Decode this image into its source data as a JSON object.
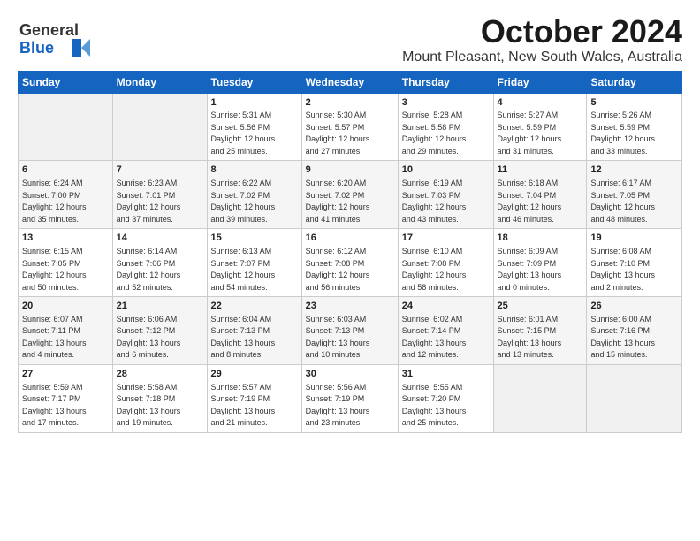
{
  "logo": {
    "line1": "General",
    "line2": "Blue"
  },
  "title": "October 2024",
  "subtitle": "Mount Pleasant, New South Wales, Australia",
  "days_of_week": [
    "Sunday",
    "Monday",
    "Tuesday",
    "Wednesday",
    "Thursday",
    "Friday",
    "Saturday"
  ],
  "weeks": [
    [
      {
        "day": "",
        "info": ""
      },
      {
        "day": "",
        "info": ""
      },
      {
        "day": "1",
        "info": "Sunrise: 5:31 AM\nSunset: 5:56 PM\nDaylight: 12 hours\nand 25 minutes."
      },
      {
        "day": "2",
        "info": "Sunrise: 5:30 AM\nSunset: 5:57 PM\nDaylight: 12 hours\nand 27 minutes."
      },
      {
        "day": "3",
        "info": "Sunrise: 5:28 AM\nSunset: 5:58 PM\nDaylight: 12 hours\nand 29 minutes."
      },
      {
        "day": "4",
        "info": "Sunrise: 5:27 AM\nSunset: 5:59 PM\nDaylight: 12 hours\nand 31 minutes."
      },
      {
        "day": "5",
        "info": "Sunrise: 5:26 AM\nSunset: 5:59 PM\nDaylight: 12 hours\nand 33 minutes."
      }
    ],
    [
      {
        "day": "6",
        "info": "Sunrise: 6:24 AM\nSunset: 7:00 PM\nDaylight: 12 hours\nand 35 minutes."
      },
      {
        "day": "7",
        "info": "Sunrise: 6:23 AM\nSunset: 7:01 PM\nDaylight: 12 hours\nand 37 minutes."
      },
      {
        "day": "8",
        "info": "Sunrise: 6:22 AM\nSunset: 7:02 PM\nDaylight: 12 hours\nand 39 minutes."
      },
      {
        "day": "9",
        "info": "Sunrise: 6:20 AM\nSunset: 7:02 PM\nDaylight: 12 hours\nand 41 minutes."
      },
      {
        "day": "10",
        "info": "Sunrise: 6:19 AM\nSunset: 7:03 PM\nDaylight: 12 hours\nand 43 minutes."
      },
      {
        "day": "11",
        "info": "Sunrise: 6:18 AM\nSunset: 7:04 PM\nDaylight: 12 hours\nand 46 minutes."
      },
      {
        "day": "12",
        "info": "Sunrise: 6:17 AM\nSunset: 7:05 PM\nDaylight: 12 hours\nand 48 minutes."
      }
    ],
    [
      {
        "day": "13",
        "info": "Sunrise: 6:15 AM\nSunset: 7:05 PM\nDaylight: 12 hours\nand 50 minutes."
      },
      {
        "day": "14",
        "info": "Sunrise: 6:14 AM\nSunset: 7:06 PM\nDaylight: 12 hours\nand 52 minutes."
      },
      {
        "day": "15",
        "info": "Sunrise: 6:13 AM\nSunset: 7:07 PM\nDaylight: 12 hours\nand 54 minutes."
      },
      {
        "day": "16",
        "info": "Sunrise: 6:12 AM\nSunset: 7:08 PM\nDaylight: 12 hours\nand 56 minutes."
      },
      {
        "day": "17",
        "info": "Sunrise: 6:10 AM\nSunset: 7:08 PM\nDaylight: 12 hours\nand 58 minutes."
      },
      {
        "day": "18",
        "info": "Sunrise: 6:09 AM\nSunset: 7:09 PM\nDaylight: 13 hours\nand 0 minutes."
      },
      {
        "day": "19",
        "info": "Sunrise: 6:08 AM\nSunset: 7:10 PM\nDaylight: 13 hours\nand 2 minutes."
      }
    ],
    [
      {
        "day": "20",
        "info": "Sunrise: 6:07 AM\nSunset: 7:11 PM\nDaylight: 13 hours\nand 4 minutes."
      },
      {
        "day": "21",
        "info": "Sunrise: 6:06 AM\nSunset: 7:12 PM\nDaylight: 13 hours\nand 6 minutes."
      },
      {
        "day": "22",
        "info": "Sunrise: 6:04 AM\nSunset: 7:13 PM\nDaylight: 13 hours\nand 8 minutes."
      },
      {
        "day": "23",
        "info": "Sunrise: 6:03 AM\nSunset: 7:13 PM\nDaylight: 13 hours\nand 10 minutes."
      },
      {
        "day": "24",
        "info": "Sunrise: 6:02 AM\nSunset: 7:14 PM\nDaylight: 13 hours\nand 12 minutes."
      },
      {
        "day": "25",
        "info": "Sunrise: 6:01 AM\nSunset: 7:15 PM\nDaylight: 13 hours\nand 13 minutes."
      },
      {
        "day": "26",
        "info": "Sunrise: 6:00 AM\nSunset: 7:16 PM\nDaylight: 13 hours\nand 15 minutes."
      }
    ],
    [
      {
        "day": "27",
        "info": "Sunrise: 5:59 AM\nSunset: 7:17 PM\nDaylight: 13 hours\nand 17 minutes."
      },
      {
        "day": "28",
        "info": "Sunrise: 5:58 AM\nSunset: 7:18 PM\nDaylight: 13 hours\nand 19 minutes."
      },
      {
        "day": "29",
        "info": "Sunrise: 5:57 AM\nSunset: 7:19 PM\nDaylight: 13 hours\nand 21 minutes."
      },
      {
        "day": "30",
        "info": "Sunrise: 5:56 AM\nSunset: 7:19 PM\nDaylight: 13 hours\nand 23 minutes."
      },
      {
        "day": "31",
        "info": "Sunrise: 5:55 AM\nSunset: 7:20 PM\nDaylight: 13 hours\nand 25 minutes."
      },
      {
        "day": "",
        "info": ""
      },
      {
        "day": "",
        "info": ""
      }
    ]
  ]
}
